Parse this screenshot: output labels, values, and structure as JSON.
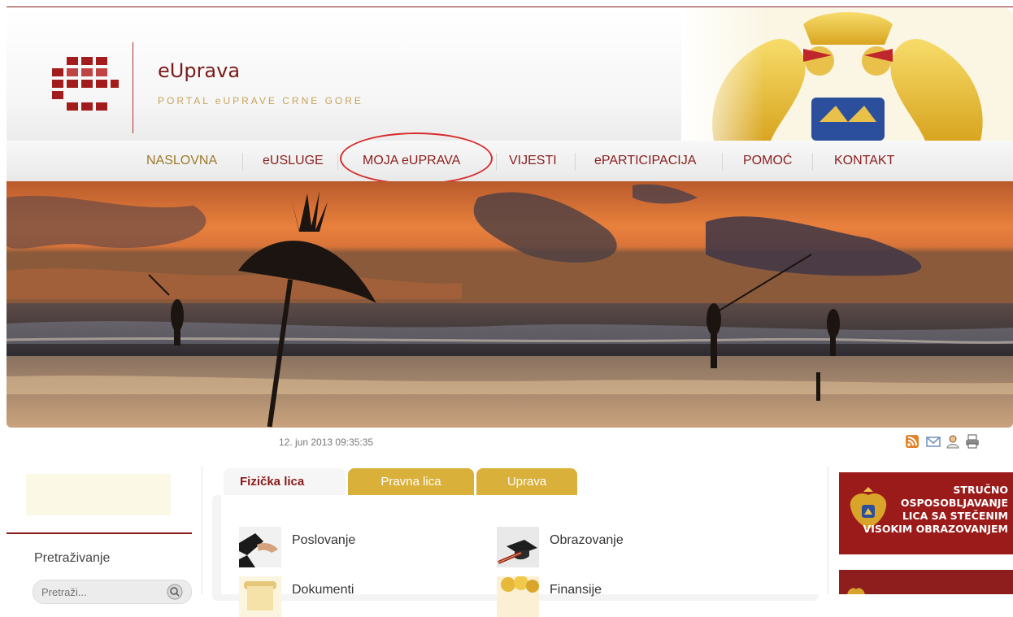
{
  "header": {
    "title": "eUprava",
    "subtitle": "PORTAL eUPRAVE CRNE GORE"
  },
  "nav": {
    "items": [
      {
        "label": "NASLOVNA"
      },
      {
        "label": "eUSLUGE"
      },
      {
        "label": "MOJA eUPRAVA"
      },
      {
        "label": "VIJESTI"
      },
      {
        "label": "ePARTICIPACIJA"
      },
      {
        "label": "POMOĆ"
      },
      {
        "label": "KONTAKT"
      }
    ],
    "highlighted": "MOJA eUPRAVA"
  },
  "info_bar": {
    "date": "12. jun 2013 09:35:35",
    "tools": [
      "rss-icon",
      "mail-icon",
      "user-icon",
      "print-icon"
    ]
  },
  "sidebar": {
    "search_label": "Pretraživanje",
    "search_placeholder": "Pretraži..."
  },
  "tabs": [
    {
      "label": "Fizička lica",
      "active": true
    },
    {
      "label": "Pravna lica",
      "active": false
    },
    {
      "label": "Uprava",
      "active": false
    }
  ],
  "services": [
    {
      "label": "Poslovanje",
      "icon": "handshake-icon"
    },
    {
      "label": "Obrazovanje",
      "icon": "graduation-cap-icon"
    },
    {
      "label": "Dokumenti",
      "icon": "scroll-icon"
    },
    {
      "label": "Finansije",
      "icon": "coins-icon"
    }
  ],
  "ads": [
    {
      "text_lines": [
        "STRUČNO",
        "OSPOSOBLJAVANJE",
        "LICA SA STEČENIM",
        "VISOKIM OBRAZOVANJEM"
      ]
    }
  ],
  "colors": {
    "brand_red": "#8b1a1a",
    "gold": "#d9b03a",
    "nav_text": "#8b2020",
    "nav_first": "#9b7b2a"
  }
}
